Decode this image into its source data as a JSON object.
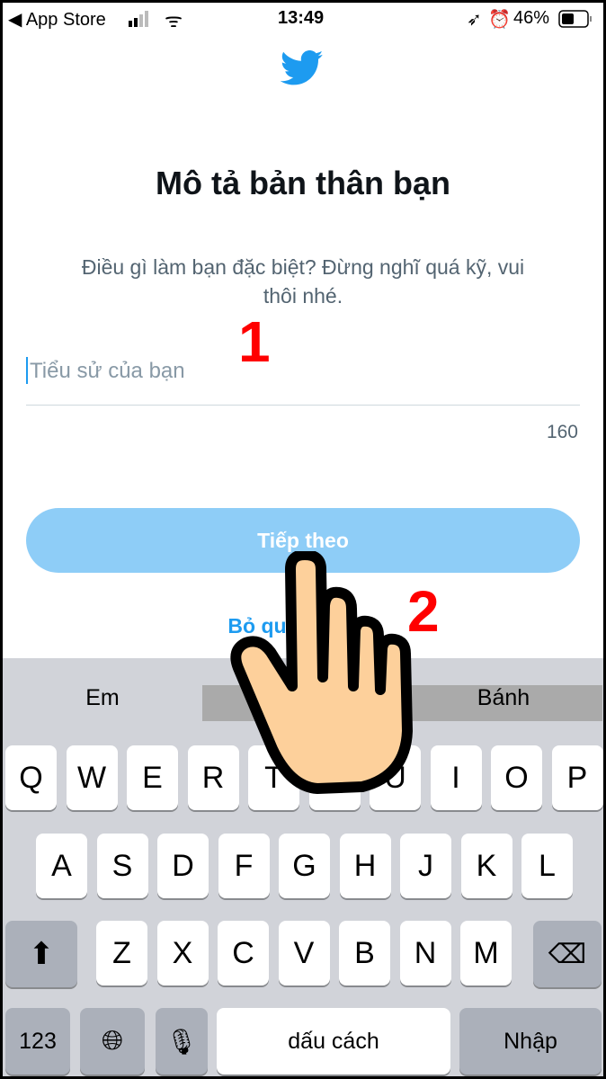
{
  "status_bar": {
    "back_app": "◀ App Store",
    "time": "13:49",
    "battery": "46%"
  },
  "logo": "twitter-bird",
  "page": {
    "title": "Mô tả bản thân bạn",
    "subtitle": "Điều gì làm bạn đặc biệt? Đừng nghĩ quá kỹ, vui thôi nhé.",
    "bio_placeholder": "Tiểu sử của bạn",
    "char_count": "160",
    "next_label": "Tiếp theo",
    "skip_label": "Bỏ qua bây giờ"
  },
  "annotations": [
    "1",
    "2"
  ],
  "keyboard": {
    "suggestions": [
      "Em",
      "",
      "Bánh"
    ],
    "row1": [
      "Q",
      "W",
      "E",
      "R",
      "T",
      "Y",
      "U",
      "I",
      "O",
      "P"
    ],
    "row2": [
      "A",
      "S",
      "D",
      "F",
      "G",
      "H",
      "J",
      "K",
      "L"
    ],
    "row3": [
      "Z",
      "X",
      "C",
      "V",
      "B",
      "N",
      "M"
    ],
    "numbers": "123",
    "space": "dấu cách",
    "return": "Nhập"
  },
  "colors": {
    "accent": "#1d9bf0",
    "button_disabled": "#8ecdf7",
    "annotation": "#ff0000"
  }
}
